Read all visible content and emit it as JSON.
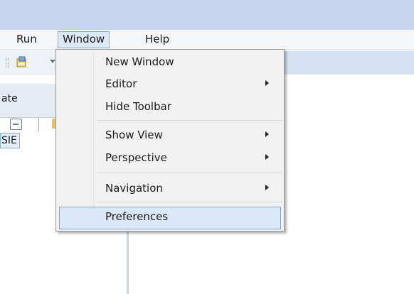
{
  "menubar": {
    "items": [
      {
        "label": "Run"
      },
      {
        "label": "Window"
      },
      {
        "label": "Help"
      }
    ]
  },
  "left_pane": {
    "tab_label": "ate",
    "selected_item": "SIE"
  },
  "window_menu": {
    "items": [
      {
        "label": "New Window",
        "has_submenu": false
      },
      {
        "label": "Editor",
        "has_submenu": true
      },
      {
        "label": "Hide Toolbar",
        "has_submenu": false
      },
      {
        "label": "Show View",
        "has_submenu": true
      },
      {
        "label": "Perspective",
        "has_submenu": true
      },
      {
        "label": "Navigation",
        "has_submenu": true
      },
      {
        "label": "Preferences",
        "has_submenu": false,
        "highlighted": true
      }
    ]
  },
  "icons": [
    "drag-handle-icon",
    "toolbar-action-icon",
    "dropdown-arrow-icon",
    "collapse-all-icon",
    "folder-icon",
    "submenu-arrow-icon"
  ],
  "colors": {
    "titlebar": "#c4d7ee",
    "menu_open_bg": "#dce9f7",
    "highlight_bg": "#dae8f8",
    "highlight_border": "#7da2ce"
  }
}
